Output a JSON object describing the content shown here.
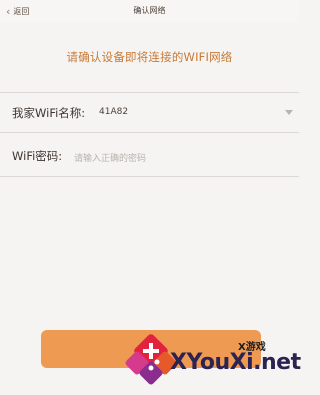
{
  "header": {
    "back_label": "返回",
    "title": "确认网络"
  },
  "subtitle": "请确认设备即将连接的WIFI网络",
  "wifi_name": {
    "label": "我家WiFi名称:",
    "value": "41A82"
  },
  "wifi_password": {
    "label": "WiFi密码:",
    "placeholder": "请输入正确的密码"
  },
  "watermark": {
    "tag": "X游戏",
    "site": "XYouXi.net"
  },
  "colors": {
    "accent": "#c77a36",
    "button": "#ee9a52",
    "background": "#f5f4f2"
  }
}
